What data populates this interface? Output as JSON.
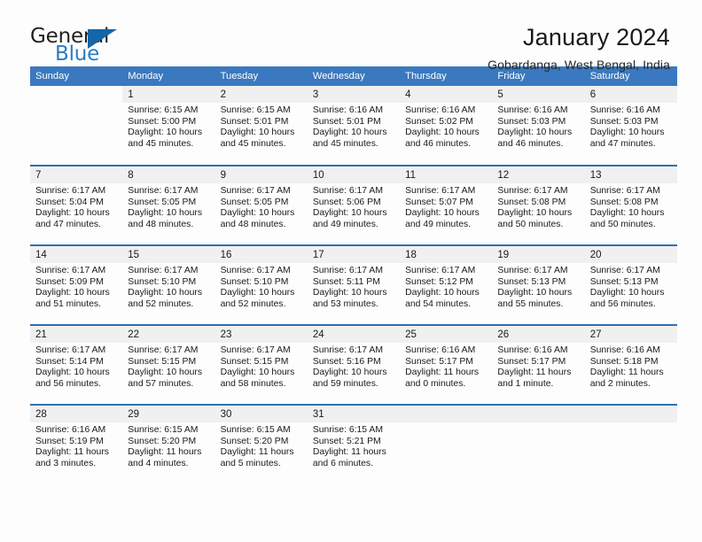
{
  "brand": {
    "name_part1": "General",
    "name_part2": "Blue",
    "triangle_icon": "triangle-icon",
    "accent_color": "#2b7cc4",
    "triangle_color": "#1565a8"
  },
  "header": {
    "title": "January 2024",
    "subtitle": "Gobardanga, West Bengal, India"
  },
  "calendar": {
    "header_bg": "#3a79bf",
    "header_text_color": "#ffffff",
    "row_border_color": "#2f6fb5",
    "daynum_band_bg": "#f0f0f0",
    "weekday_headers": [
      "Sunday",
      "Monday",
      "Tuesday",
      "Wednesday",
      "Thursday",
      "Friday",
      "Saturday"
    ],
    "weeks": [
      [
        {
          "day": "",
          "blank": true,
          "lines": []
        },
        {
          "day": "1",
          "lines": [
            "Sunrise: 6:15 AM",
            "Sunset: 5:00 PM",
            "Daylight: 10 hours",
            "and 45 minutes."
          ]
        },
        {
          "day": "2",
          "lines": [
            "Sunrise: 6:15 AM",
            "Sunset: 5:01 PM",
            "Daylight: 10 hours",
            "and 45 minutes."
          ]
        },
        {
          "day": "3",
          "lines": [
            "Sunrise: 6:16 AM",
            "Sunset: 5:01 PM",
            "Daylight: 10 hours",
            "and 45 minutes."
          ]
        },
        {
          "day": "4",
          "lines": [
            "Sunrise: 6:16 AM",
            "Sunset: 5:02 PM",
            "Daylight: 10 hours",
            "and 46 minutes."
          ]
        },
        {
          "day": "5",
          "lines": [
            "Sunrise: 6:16 AM",
            "Sunset: 5:03 PM",
            "Daylight: 10 hours",
            "and 46 minutes."
          ]
        },
        {
          "day": "6",
          "lines": [
            "Sunrise: 6:16 AM",
            "Sunset: 5:03 PM",
            "Daylight: 10 hours",
            "and 47 minutes."
          ]
        }
      ],
      [
        {
          "day": "7",
          "lines": [
            "Sunrise: 6:17 AM",
            "Sunset: 5:04 PM",
            "Daylight: 10 hours",
            "and 47 minutes."
          ]
        },
        {
          "day": "8",
          "lines": [
            "Sunrise: 6:17 AM",
            "Sunset: 5:05 PM",
            "Daylight: 10 hours",
            "and 48 minutes."
          ]
        },
        {
          "day": "9",
          "lines": [
            "Sunrise: 6:17 AM",
            "Sunset: 5:05 PM",
            "Daylight: 10 hours",
            "and 48 minutes."
          ]
        },
        {
          "day": "10",
          "lines": [
            "Sunrise: 6:17 AM",
            "Sunset: 5:06 PM",
            "Daylight: 10 hours",
            "and 49 minutes."
          ]
        },
        {
          "day": "11",
          "lines": [
            "Sunrise: 6:17 AM",
            "Sunset: 5:07 PM",
            "Daylight: 10 hours",
            "and 49 minutes."
          ]
        },
        {
          "day": "12",
          "lines": [
            "Sunrise: 6:17 AM",
            "Sunset: 5:08 PM",
            "Daylight: 10 hours",
            "and 50 minutes."
          ]
        },
        {
          "day": "13",
          "lines": [
            "Sunrise: 6:17 AM",
            "Sunset: 5:08 PM",
            "Daylight: 10 hours",
            "and 50 minutes."
          ]
        }
      ],
      [
        {
          "day": "14",
          "lines": [
            "Sunrise: 6:17 AM",
            "Sunset: 5:09 PM",
            "Daylight: 10 hours",
            "and 51 minutes."
          ]
        },
        {
          "day": "15",
          "lines": [
            "Sunrise: 6:17 AM",
            "Sunset: 5:10 PM",
            "Daylight: 10 hours",
            "and 52 minutes."
          ]
        },
        {
          "day": "16",
          "lines": [
            "Sunrise: 6:17 AM",
            "Sunset: 5:10 PM",
            "Daylight: 10 hours",
            "and 52 minutes."
          ]
        },
        {
          "day": "17",
          "lines": [
            "Sunrise: 6:17 AM",
            "Sunset: 5:11 PM",
            "Daylight: 10 hours",
            "and 53 minutes."
          ]
        },
        {
          "day": "18",
          "lines": [
            "Sunrise: 6:17 AM",
            "Sunset: 5:12 PM",
            "Daylight: 10 hours",
            "and 54 minutes."
          ]
        },
        {
          "day": "19",
          "lines": [
            "Sunrise: 6:17 AM",
            "Sunset: 5:13 PM",
            "Daylight: 10 hours",
            "and 55 minutes."
          ]
        },
        {
          "day": "20",
          "lines": [
            "Sunrise: 6:17 AM",
            "Sunset: 5:13 PM",
            "Daylight: 10 hours",
            "and 56 minutes."
          ]
        }
      ],
      [
        {
          "day": "21",
          "lines": [
            "Sunrise: 6:17 AM",
            "Sunset: 5:14 PM",
            "Daylight: 10 hours",
            "and 56 minutes."
          ]
        },
        {
          "day": "22",
          "lines": [
            "Sunrise: 6:17 AM",
            "Sunset: 5:15 PM",
            "Daylight: 10 hours",
            "and 57 minutes."
          ]
        },
        {
          "day": "23",
          "lines": [
            "Sunrise: 6:17 AM",
            "Sunset: 5:15 PM",
            "Daylight: 10 hours",
            "and 58 minutes."
          ]
        },
        {
          "day": "24",
          "lines": [
            "Sunrise: 6:17 AM",
            "Sunset: 5:16 PM",
            "Daylight: 10 hours",
            "and 59 minutes."
          ]
        },
        {
          "day": "25",
          "lines": [
            "Sunrise: 6:16 AM",
            "Sunset: 5:17 PM",
            "Daylight: 11 hours",
            "and 0 minutes."
          ]
        },
        {
          "day": "26",
          "lines": [
            "Sunrise: 6:16 AM",
            "Sunset: 5:17 PM",
            "Daylight: 11 hours",
            "and 1 minute."
          ]
        },
        {
          "day": "27",
          "lines": [
            "Sunrise: 6:16 AM",
            "Sunset: 5:18 PM",
            "Daylight: 11 hours",
            "and 2 minutes."
          ]
        }
      ],
      [
        {
          "day": "28",
          "lines": [
            "Sunrise: 6:16 AM",
            "Sunset: 5:19 PM",
            "Daylight: 11 hours",
            "and 3 minutes."
          ]
        },
        {
          "day": "29",
          "lines": [
            "Sunrise: 6:15 AM",
            "Sunset: 5:20 PM",
            "Daylight: 11 hours",
            "and 4 minutes."
          ]
        },
        {
          "day": "30",
          "lines": [
            "Sunrise: 6:15 AM",
            "Sunset: 5:20 PM",
            "Daylight: 11 hours",
            "and 5 minutes."
          ]
        },
        {
          "day": "31",
          "lines": [
            "Sunrise: 6:15 AM",
            "Sunset: 5:21 PM",
            "Daylight: 11 hours",
            "and 6 minutes."
          ]
        },
        {
          "day": "",
          "empty": true,
          "lines": []
        },
        {
          "day": "",
          "empty": true,
          "lines": []
        },
        {
          "day": "",
          "empty": true,
          "lines": []
        }
      ]
    ]
  }
}
